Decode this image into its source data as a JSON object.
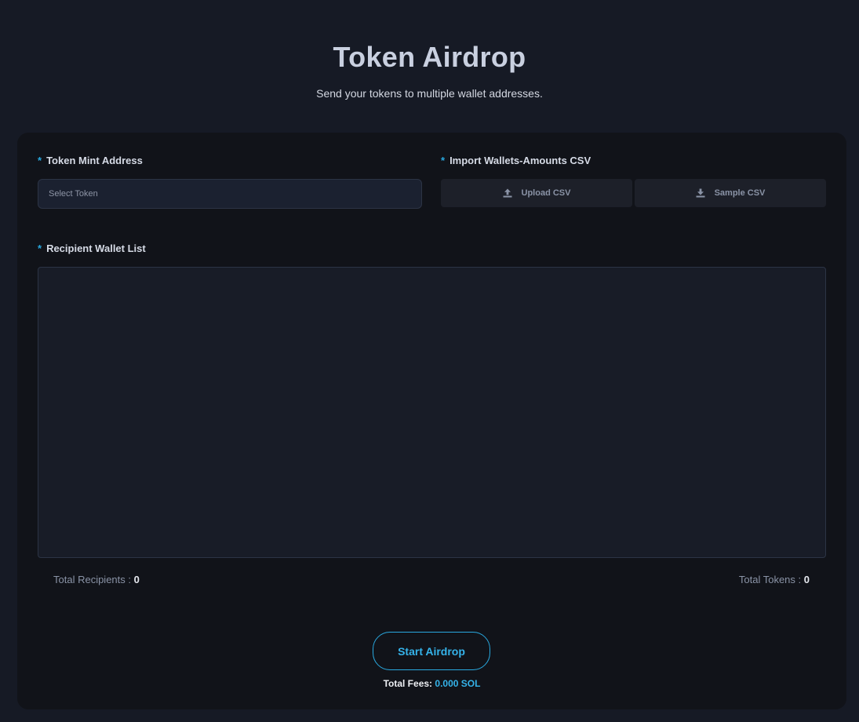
{
  "header": {
    "title": "Token Airdrop",
    "subtitle": "Send your tokens to multiple wallet addresses."
  },
  "form": {
    "required_marker": "*",
    "mint_label": "Token Mint Address",
    "mint_placeholder": "Select Token",
    "csv_label": "Import Wallets-Amounts CSV",
    "upload_label": "Upload CSV",
    "sample_label": "Sample CSV",
    "recipient_label": "Recipient Wallet List",
    "recipient_value": ""
  },
  "stats": {
    "recipients_label": "Total Recipients :",
    "recipients_value": "0",
    "tokens_label": "Total Tokens :",
    "tokens_value": "0"
  },
  "action": {
    "start_label": "Start Airdrop",
    "fees_label": "Total Fees:",
    "fees_value": "0.000 SOL"
  },
  "icons": {
    "upload": "upload-icon",
    "download": "download-icon"
  },
  "colors": {
    "accent": "#29a9e0",
    "background": "#161a25",
    "card": "#111319"
  }
}
